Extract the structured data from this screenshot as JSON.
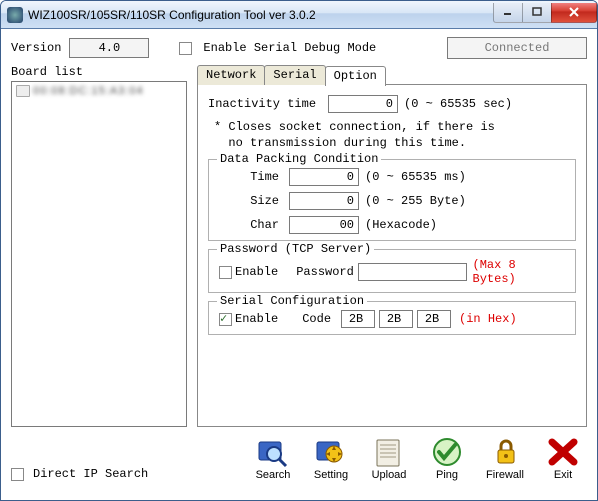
{
  "window": {
    "title": "WIZ100SR/105SR/110SR Configuration Tool ver 3.0.2"
  },
  "top": {
    "version_label": "Version",
    "version_value": "4.0",
    "debug_label": "Enable Serial Debug Mode",
    "status": "Connected"
  },
  "board": {
    "label": "Board list",
    "items": [
      "00:08:DC:15:A3:04"
    ]
  },
  "tabs": {
    "t0": "Network",
    "t1": "Serial",
    "t2": "Option"
  },
  "option": {
    "inactivity_label": "Inactivity time",
    "inactivity_value": "0",
    "inactivity_hint": "(0 ~ 65535 sec)",
    "note": "* Closes socket connection, if there is\n  no transmission during this time.",
    "pack_legend": "Data Packing Condition",
    "pack_time_label": "Time",
    "pack_time_value": "0",
    "pack_time_hint": "(0 ~ 65535 ms)",
    "pack_size_label": "Size",
    "pack_size_value": "0",
    "pack_size_hint": "(0 ~ 255 Byte)",
    "pack_char_label": "Char",
    "pack_char_value": "00",
    "pack_char_hint": "(Hexacode)",
    "pw_legend": "Password (TCP Server)",
    "pw_enable_label": "Enable",
    "pw_password_label": "Password",
    "pw_hint": "(Max 8 Bytes)",
    "sc_legend": "Serial Configuration",
    "sc_enable_label": "Enable",
    "sc_code_label": "Code",
    "sc_code0": "2B",
    "sc_code1": "2B",
    "sc_code2": "2B",
    "sc_hint": "(in Hex)"
  },
  "bottom": {
    "direct_ip": "Direct IP Search"
  },
  "toolbar": {
    "search": "Search",
    "setting": "Setting",
    "upload": "Upload",
    "ping": "Ping",
    "firewall": "Firewall",
    "exit": "Exit"
  }
}
